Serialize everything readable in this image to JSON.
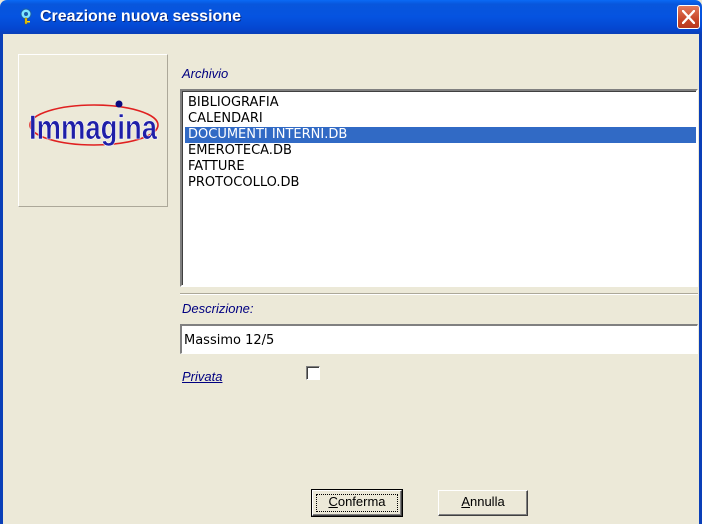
{
  "window": {
    "title": "Creazione nuova sessione",
    "title_icon": "key-icon",
    "close_icon": "close-icon"
  },
  "logo": {
    "text": "Immagina",
    "colors": {
      "text": "#1f1fa8",
      "ellipse": "#e02020",
      "dot": "#0a0a80"
    }
  },
  "archivio": {
    "label": "Archivio",
    "items": [
      "BIBLIOGRAFIA",
      "CALENDARI",
      "DOCUMENTI INTERNI.DB",
      "EMEROTECA.DB",
      "FATTURE",
      "PROTOCOLLO.DB"
    ],
    "selected_index": 2
  },
  "descrizione": {
    "label": "Descrizione:",
    "value": "Massimo 12/5"
  },
  "privata": {
    "label": "Privata",
    "checked": false
  },
  "buttons": {
    "conferma": {
      "first": "C",
      "rest": "onferma"
    },
    "annulla": {
      "first": "A",
      "rest": "nnulla"
    }
  },
  "colors": {
    "selection": "#316ac5",
    "label": "#000080",
    "titlebar": "#0553e0"
  }
}
